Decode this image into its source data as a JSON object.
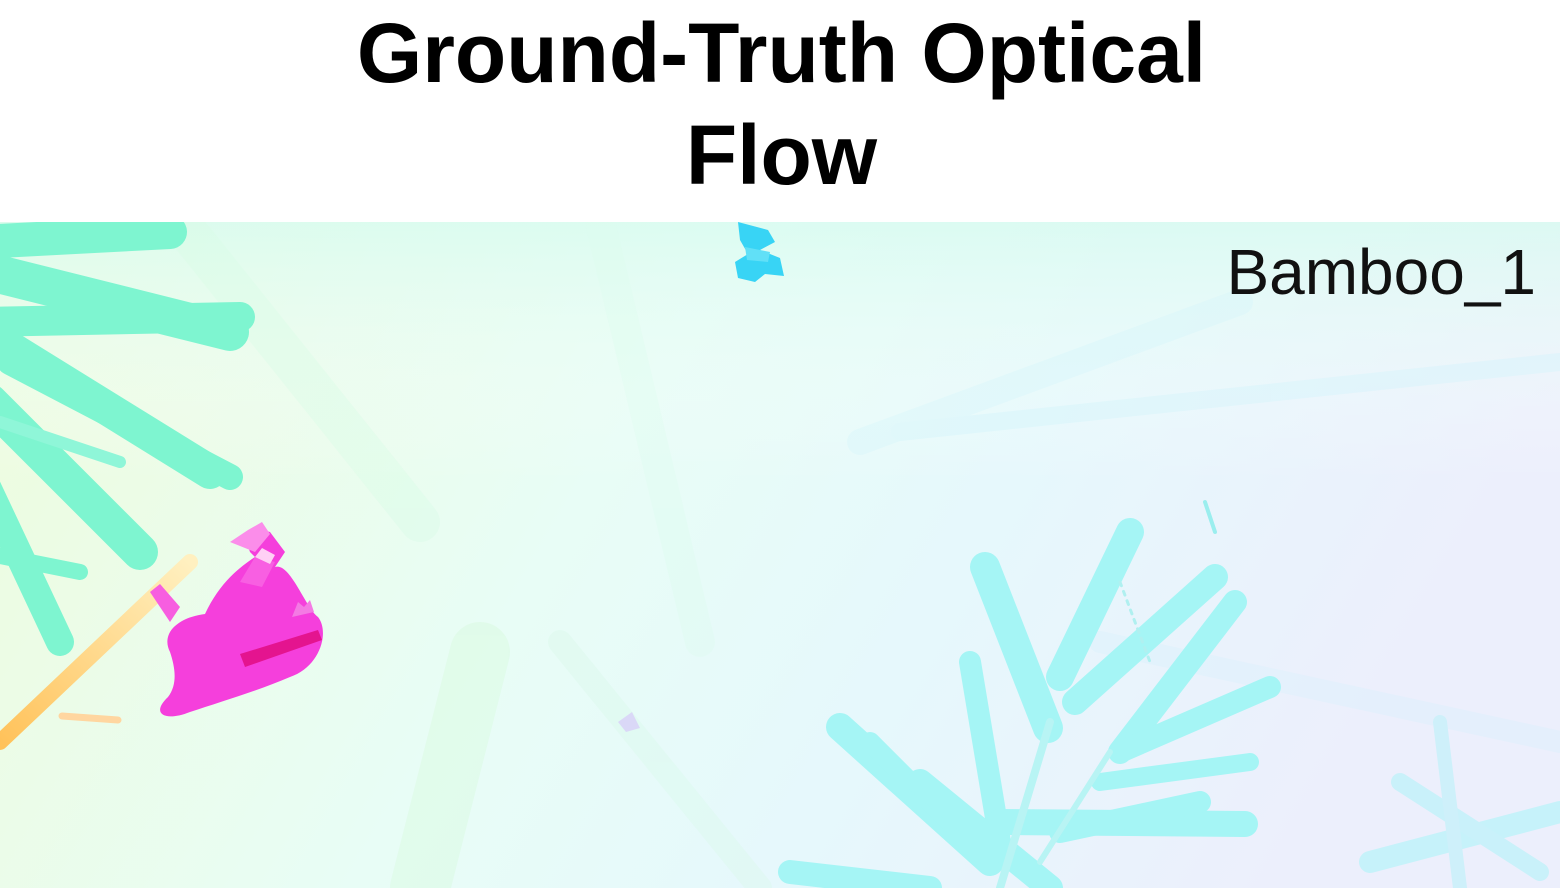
{
  "figure": {
    "title_line_1": "Ground-Truth Optical",
    "title_line_2": "Flow",
    "sequence_label": "Bamboo_1"
  },
  "colors": {
    "background_left": "#eefcdc",
    "background_center": "#e8fdf6",
    "background_right": "#eceffc",
    "bamboo_leaves_left": "#7ef5d0",
    "bamboo_leaves_right": "#a5f5f5",
    "figure_silhouette": "#f53fdc",
    "butterfly": "#38d4f5",
    "stalk": "#ffcf70"
  }
}
